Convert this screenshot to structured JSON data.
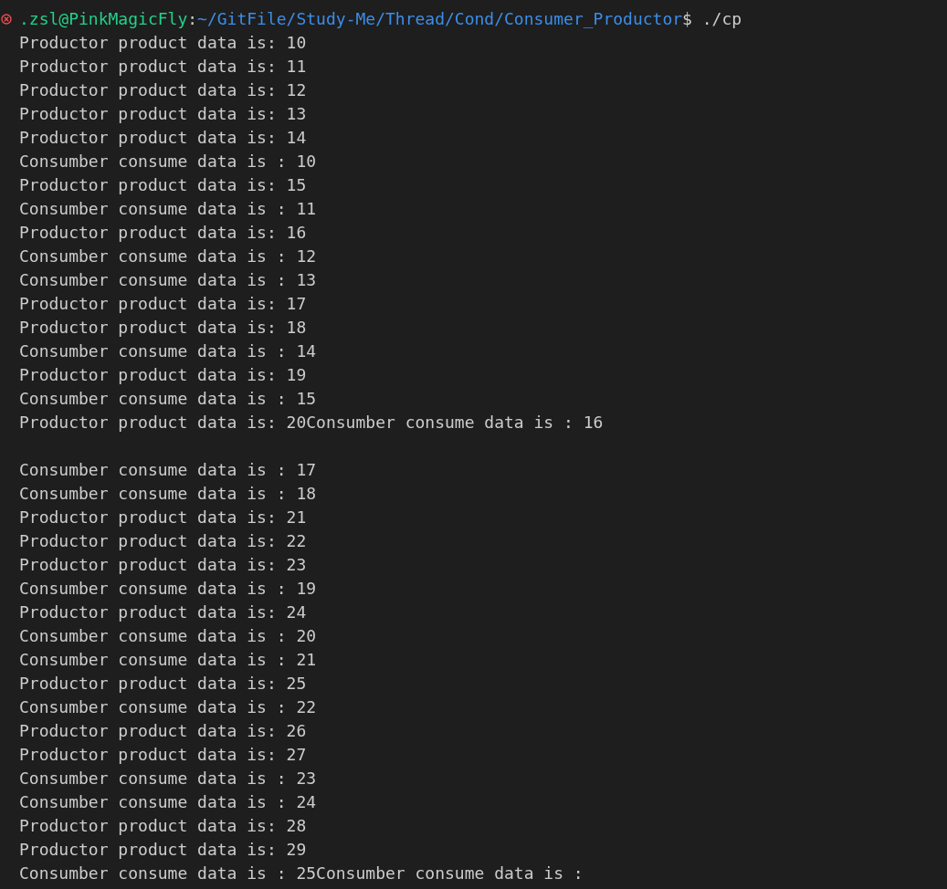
{
  "prompt": {
    "failed": true,
    "user_host": ".zsl@PinkMagicFly",
    "separator": ":",
    "path": "~/GitFile/Study-Me/Thread/Cond/Consumer_Productor",
    "symbol": "$",
    "command": "./cp"
  },
  "lines": [
    {
      "kind": "output",
      "text": "Productor product data is: 10"
    },
    {
      "kind": "output",
      "text": "Productor product data is: 11"
    },
    {
      "kind": "output",
      "text": "Productor product data is: 12"
    },
    {
      "kind": "output",
      "text": "Productor product data is: 13"
    },
    {
      "kind": "output",
      "text": "Productor product data is: 14"
    },
    {
      "kind": "output",
      "text": "Consumber consume data is : 10"
    },
    {
      "kind": "output",
      "text": "Productor product data is: 15"
    },
    {
      "kind": "output",
      "text": "Consumber consume data is : 11"
    },
    {
      "kind": "output",
      "text": "Productor product data is: 16"
    },
    {
      "kind": "output",
      "text": "Consumber consume data is : 12"
    },
    {
      "kind": "output",
      "text": "Consumber consume data is : 13"
    },
    {
      "kind": "output",
      "text": "Productor product data is: 17"
    },
    {
      "kind": "output",
      "text": "Productor product data is: 18"
    },
    {
      "kind": "output",
      "text": "Consumber consume data is : 14"
    },
    {
      "kind": "output",
      "text": "Productor product data is: 19"
    },
    {
      "kind": "output",
      "text": "Consumber consume data is : 15"
    },
    {
      "kind": "output",
      "text": "Productor product data is: 20Consumber consume data is : 16"
    },
    {
      "kind": "blank"
    },
    {
      "kind": "output",
      "text": "Consumber consume data is : 17"
    },
    {
      "kind": "output",
      "text": "Consumber consume data is : 18"
    },
    {
      "kind": "output",
      "text": "Productor product data is: 21"
    },
    {
      "kind": "output",
      "text": "Productor product data is: 22"
    },
    {
      "kind": "output",
      "text": "Productor product data is: 23"
    },
    {
      "kind": "output",
      "text": "Consumber consume data is : 19"
    },
    {
      "kind": "output",
      "text": "Productor product data is: 24"
    },
    {
      "kind": "output",
      "text": "Consumber consume data is : 20"
    },
    {
      "kind": "output",
      "text": "Consumber consume data is : 21"
    },
    {
      "kind": "output",
      "text": "Productor product data is: 25"
    },
    {
      "kind": "output",
      "text": "Consumber consume data is : 22"
    },
    {
      "kind": "output",
      "text": "Productor product data is: 26"
    },
    {
      "kind": "output",
      "text": "Productor product data is: 27"
    },
    {
      "kind": "output",
      "text": "Consumber consume data is : 23"
    },
    {
      "kind": "output",
      "text": "Consumber consume data is : 24"
    },
    {
      "kind": "output",
      "text": "Productor product data is: 28"
    },
    {
      "kind": "output",
      "text": "Productor product data is: 29"
    },
    {
      "kind": "output",
      "text": "Consumber consume data is : 25Consumber consume data is :"
    }
  ]
}
